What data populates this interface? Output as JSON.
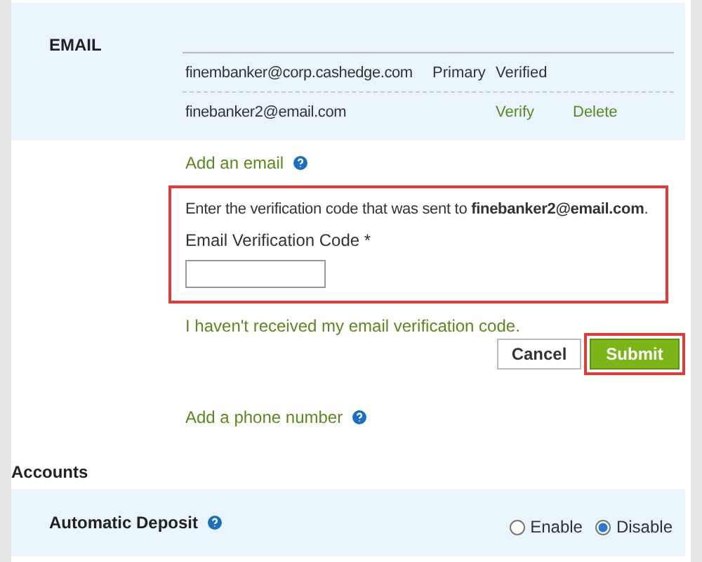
{
  "email_section": {
    "heading": "EMAIL",
    "rows": [
      {
        "address": "finembanker@corp.cashedge.com",
        "primary": "Primary",
        "cells": [
          {
            "kind": "text",
            "text": "Verified"
          }
        ]
      },
      {
        "address": "finebanker2@email.com",
        "cells": [
          {
            "kind": "link",
            "text": "Verify"
          },
          {
            "kind": "link",
            "text": "Delete"
          }
        ]
      }
    ],
    "add_link": "Add an email"
  },
  "verify_form": {
    "message": "Enter the verification code that was sent to **finebanker2@email.com**.",
    "field_label": "Email Verification Code *",
    "resend_link": "I haven't received my email verification code.",
    "buttons": [
      {
        "kind": "secondary",
        "label": "Cancel"
      },
      {
        "kind": "primary",
        "label": "Submit"
      }
    ]
  },
  "add_phone_link": "Add a phone number",
  "accounts": {
    "heading": "Accounts",
    "setting": "Automatic Deposit",
    "options": [
      {
        "label": "Enable",
        "selected": false
      },
      {
        "label": "Disable",
        "selected": true
      }
    ]
  }
}
